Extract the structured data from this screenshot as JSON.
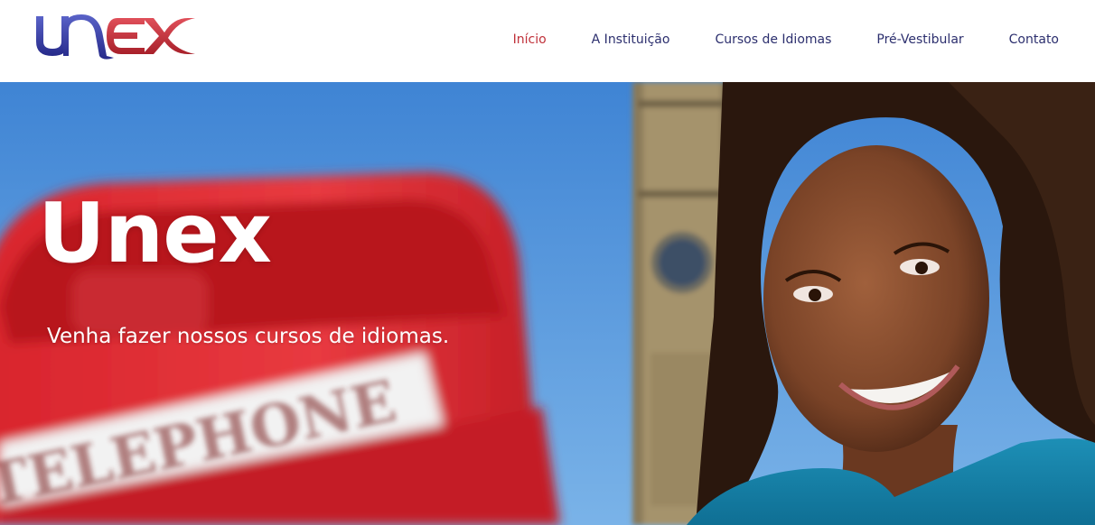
{
  "brand": {
    "logo_text": "UNEX",
    "colors": {
      "primary": "#2c2f6e",
      "accent": "#c0313a"
    }
  },
  "nav": {
    "items": [
      {
        "label": "Início",
        "active": true
      },
      {
        "label": "A Instituição",
        "active": false
      },
      {
        "label": "Cursos de Idiomas",
        "active": false
      },
      {
        "label": "Pré-Vestibular",
        "active": false
      },
      {
        "label": "Contato",
        "active": false
      }
    ]
  },
  "hero": {
    "title": "Unex",
    "subtitle": "Venha fazer nossos cursos de idiomas.",
    "phone_sign": "TELEPHONE"
  }
}
